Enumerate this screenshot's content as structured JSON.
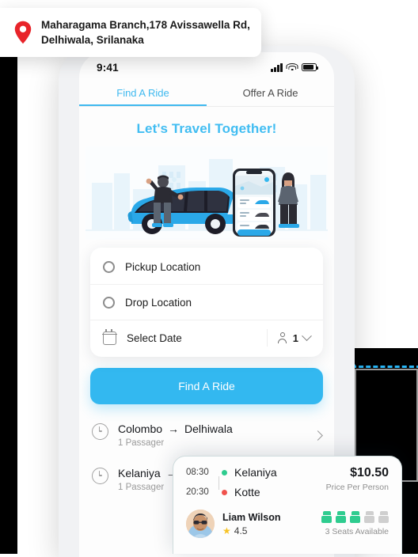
{
  "address_card": {
    "icon": "map-pin-icon",
    "text": "Maharagama Branch,178 Avissawella Rd, Delhiwala, Srilanaka",
    "pin_color": "#e8242a"
  },
  "status_bar": {
    "time": "9:41",
    "icons": [
      "signal-bars-icon",
      "wifi-icon",
      "battery-icon"
    ]
  },
  "tabs": [
    {
      "label": "Find A Ride",
      "active": true
    },
    {
      "label": "Offer A Ride",
      "active": false
    }
  ],
  "headline": "Let's Travel Together!",
  "accent_color": "#33b8f0",
  "hero": {
    "name": "rideshare-illustration",
    "elements": [
      "blue-car",
      "man-standing",
      "woman-standing",
      "phone-mockup",
      "city-skyline"
    ]
  },
  "form": {
    "rows": [
      {
        "icon": "circle-outline-icon",
        "label": "Pickup Location"
      },
      {
        "icon": "circle-outline-icon",
        "label": "Drop Location"
      },
      {
        "icon": "calendar-icon",
        "label": "Select Date"
      }
    ],
    "passengers": {
      "icon": "person-icon",
      "value": "1",
      "chevron": "chevron-down-icon"
    }
  },
  "cta": {
    "label": "Find A Ride"
  },
  "rides": [
    {
      "from": "Colombo",
      "arrow": "→",
      "to": "Delhiwala",
      "passengers": "1 Passager"
    },
    {
      "from": "Kelaniya",
      "arrow": "→",
      "to": "",
      "passengers": "1 Passager"
    }
  ],
  "detail_card": {
    "legs": [
      {
        "time": "08:30",
        "place": "Kelaniya",
        "dot": "#2ecc8f"
      },
      {
        "time": "20:30",
        "place": "Kotte",
        "dot": "#f0524d"
      }
    ],
    "price": {
      "amount": "$10.50",
      "label": "Price Per Person"
    },
    "driver": {
      "name": "Liam Wilson",
      "rating": "4.5",
      "star": "★",
      "avatar": "driver-avatar"
    },
    "seats": {
      "total": 5,
      "available": 3,
      "text": "3 Seats Available",
      "on_color": "#2ecc8f",
      "off_color": "#cfcfcf"
    }
  }
}
